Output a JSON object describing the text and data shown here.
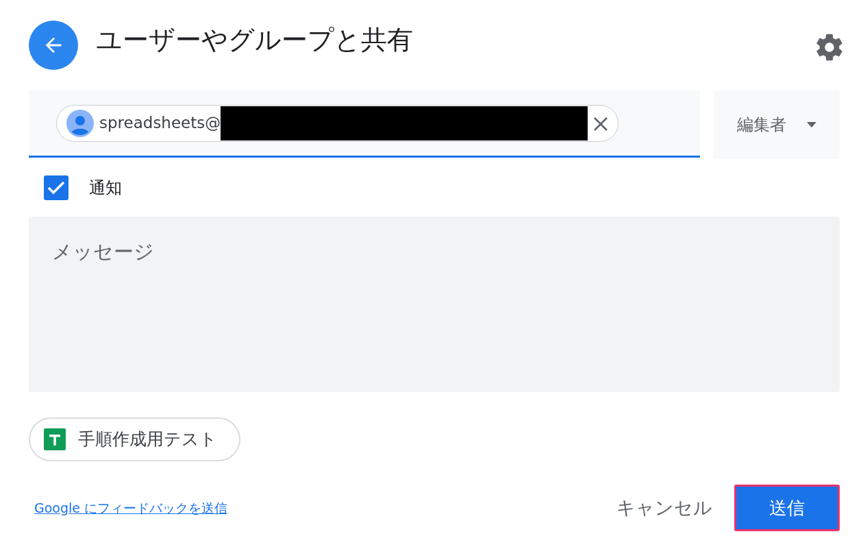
{
  "header": {
    "title": "ユーザーやグループと共有"
  },
  "recipient": {
    "chip_text": "spreadsheets@",
    "redacted": true,
    "role": "編集者"
  },
  "notify": {
    "label": "通知",
    "checked": true
  },
  "message": {
    "placeholder": "メッセージ"
  },
  "attachment": {
    "label": "手順作成用テスト"
  },
  "footer": {
    "feedback_link": "Google にフィードバックを送信",
    "cancel": "キャンセル",
    "send": "送信",
    "send_highlighted": true
  }
}
